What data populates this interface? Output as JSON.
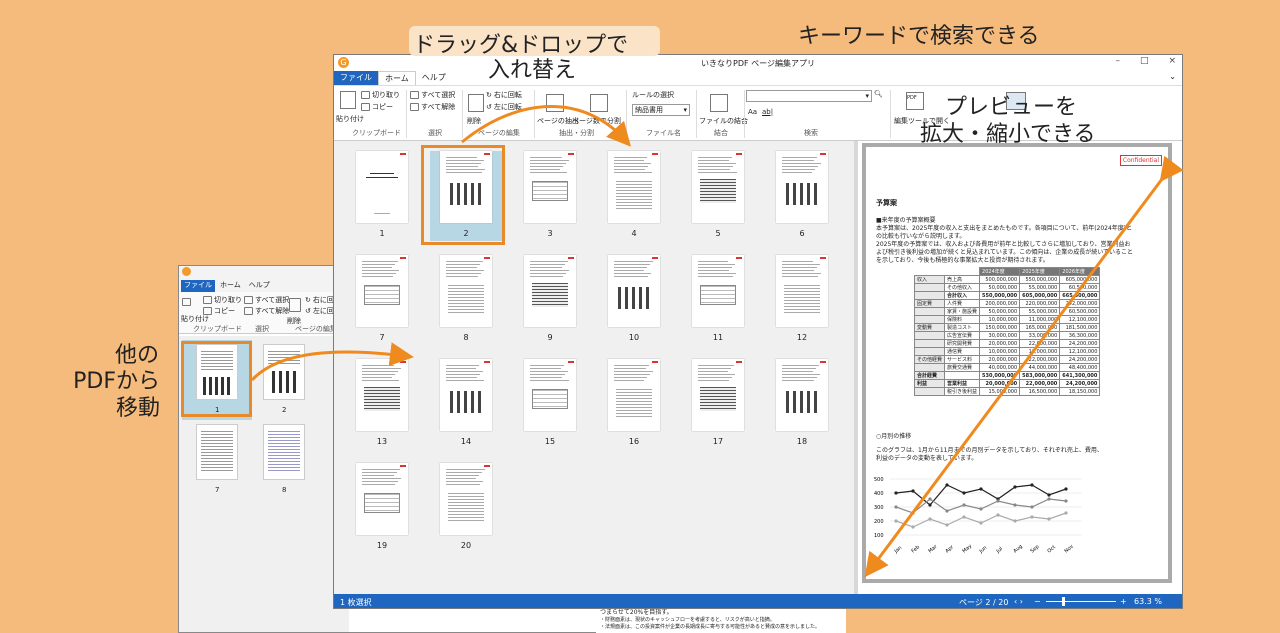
{
  "callouts": {
    "drag_drop_line1": "ドラッグ&ドロップで",
    "drag_drop_line2": "入れ替え",
    "keyword": "キーワードで検索できる",
    "preview_line1": "プレビューを",
    "preview_line2": "拡大・縮小できる",
    "other_pdf_line1": "他の",
    "other_pdf_line2": "PDFから",
    "other_pdf_line3": "移動"
  },
  "window": {
    "title": "いきなりPDF ページ編集アプリ",
    "logo": "G",
    "minimize": "–",
    "maximize": "□",
    "close": "×"
  },
  "menu": {
    "file": "ファイル",
    "home": "ホーム",
    "help": "ヘルプ",
    "chevron": "⌄"
  },
  "ribbon": {
    "paste": "貼り付け",
    "cut": "切り取り",
    "copy": "コピー",
    "clipboard_group": "クリップボード",
    "select_all": "すべて選択",
    "deselect_all": "すべて解除",
    "select_group": "選択",
    "delete": "削除",
    "rotate_right": "右に回転",
    "rotate_left": "左に回転",
    "page_edit_group": "ページの編集",
    "extract_pages": "ページの抽出",
    "split_by_pages": "ページ数で分割",
    "extract_split_group": "抽出・分割",
    "rule_select": "ルールの選択",
    "rule_value": "納品書用",
    "filename_group": "ファイル名",
    "combine_files": "ファイルの結合",
    "combine_group": "結合",
    "search_group": "検索",
    "aa": "Aa",
    "ab": "ab|",
    "edit_tool_label": "編集ツールで開く",
    "pdf_icon_label": "PDF"
  },
  "thumbnails": [
    "1",
    "2",
    "3",
    "4",
    "5",
    "6",
    "7",
    "8",
    "9",
    "10",
    "11",
    "12",
    "13",
    "14",
    "15",
    "16",
    "17",
    "18",
    "19",
    "20"
  ],
  "status": {
    "selection": "1 枚選択",
    "page_indicator": "ページ 2 / 20",
    "zoom": "63.3 %"
  },
  "preview_doc": {
    "confidential": "Confidential",
    "heading": "予算案",
    "section1": "■来年度の予算案概要",
    "para1": "本予算案は、2025年度の収入と支出をまとめたものです。各項目について、前年(2024年度)と",
    "para2": "の比較も行いながら説明します。",
    "para3": "2025年度の予算案では、収入および各費用が前年と比較してさらに増加しており、営業利益お",
    "para4": "よび税引き後利益の増加が続くと見込まれています。この傾向は、企業の成長が続いていること",
    "para5": "を示しており、今後も積極的な事業拡大と投資が期待されます。",
    "table_header": [
      "",
      "",
      "2024年度",
      "2025年度",
      "2026年度"
    ],
    "table_rows": [
      [
        "収入",
        "売上高",
        "500,000,000",
        "550,000,000",
        "605,000,000"
      ],
      [
        "",
        "その他収入",
        "50,000,000",
        "55,000,000",
        "60,500,000"
      ],
      [
        "",
        "合計収入",
        "550,000,000",
        "605,000,000",
        "665,500,000"
      ],
      [
        "固定費",
        "人件費",
        "200,000,000",
        "220,000,000",
        "242,000,000"
      ],
      [
        "",
        "家賃・施設費",
        "50,000,000",
        "55,000,000",
        "60,500,000"
      ],
      [
        "",
        "保険料",
        "10,000,000",
        "11,000,000",
        "12,100,000"
      ],
      [
        "変動費",
        "製造コスト",
        "150,000,000",
        "165,000,000",
        "181,500,000"
      ],
      [
        "",
        "広告宣伝費",
        "30,000,000",
        "33,000,000",
        "36,300,000"
      ],
      [
        "",
        "研究開発費",
        "20,000,000",
        "22,000,000",
        "24,200,000"
      ],
      [
        "",
        "通信費",
        "10,000,000",
        "11,000,000",
        "12,100,000"
      ],
      [
        "その他経費",
        "サービス料",
        "20,000,000",
        "22,000,000",
        "24,200,000"
      ],
      [
        "",
        "旅費交通費",
        "40,000,000",
        "44,000,000",
        "48,400,000"
      ],
      [
        "合計経費",
        "",
        "530,000,000",
        "583,000,000",
        "641,300,000"
      ],
      [
        "利益",
        "営業利益",
        "20,000,000",
        "22,000,000",
        "24,200,000"
      ],
      [
        "",
        "税引き後利益",
        "15,000,000",
        "16,500,000",
        "18,150,000"
      ]
    ],
    "section2": "○月別の推移",
    "para6": "このグラフは、1月から11月までの月別データを示しており、それぞれ売上、費用、",
    "para7": "利益のデータの変動を表しています。",
    "y_ticks": [
      "500",
      "400",
      "300",
      "200",
      "100"
    ],
    "x_ticks": [
      "Jan",
      "Feb",
      "Mar",
      "Apr",
      "May",
      "Jun",
      "Jul",
      "Aug",
      "Sep",
      "Oct",
      "Nov"
    ]
  },
  "back_window": {
    "menu_file": "ファイル",
    "menu_home": "ホーム",
    "menu_help": "ヘルプ",
    "cut": "切り取り",
    "copy": "コピー",
    "paste": "貼り付け",
    "select_all": "すべて選択",
    "deselect_all": "すべて解除",
    "delete": "削除",
    "rotate_right": "右に回転",
    "rotate_left": "左に回転",
    "clipboard_group": "クリップボード",
    "select_group": "選択",
    "page_edit_group": "ページの編集",
    "thumbs": [
      "1",
      "2",
      "7",
      "8"
    ],
    "bottom_text1": "つまらせて20%を目指す。",
    "bottom_text2": "・財務面素は、現状のキャッシュフローを考慮すると、リスクが高いと指摘。",
    "bottom_text3": "・法規面素は、この投資案件が企業の長期成長に寄与する可能性があると賛成の意を示しました。"
  }
}
